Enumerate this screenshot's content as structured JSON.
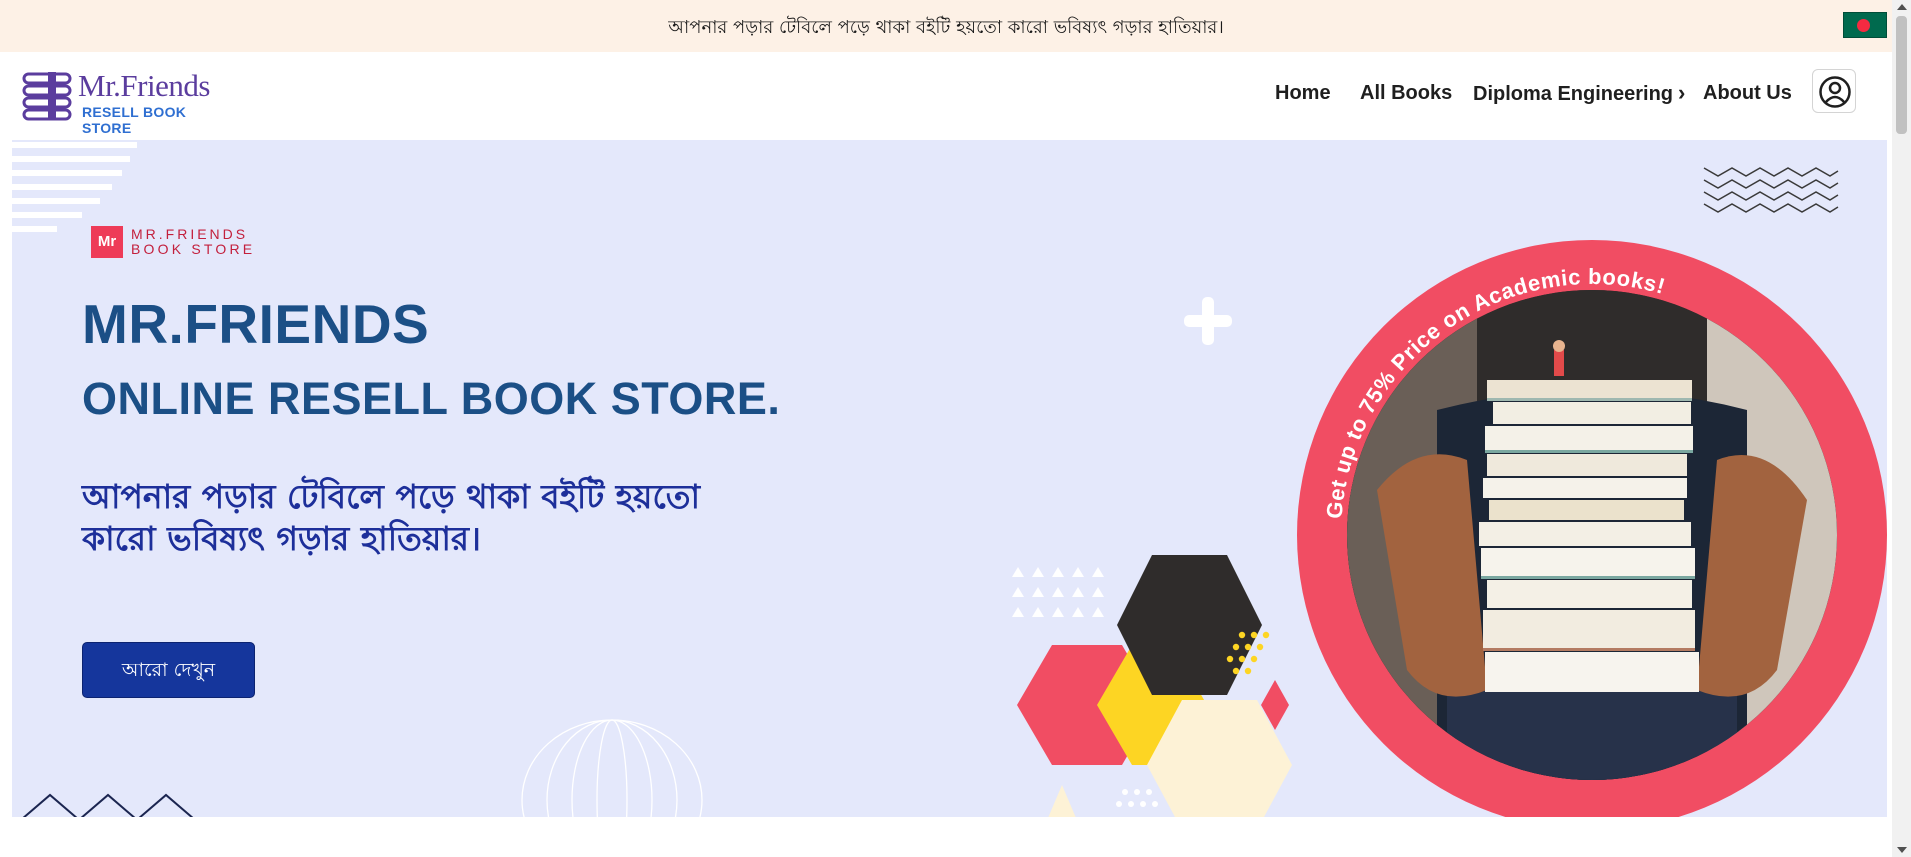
{
  "announcement": {
    "text": "আপনার পড়ার টেবিলে পড়ে থাকা বইটি হয়তো কারো ভবিষ্যৎ গড়ার হাতিয়ার।",
    "flag_icon": "bangladesh-flag-icon"
  },
  "header": {
    "logo_name": "Mr.Friends",
    "logo_tagline": "RESELL BOOK STORE",
    "nav": {
      "home": "Home",
      "all_books": "All Books",
      "diploma": "Diploma Engineering",
      "about": "About Us"
    },
    "user_icon": "user-circle-icon"
  },
  "hero": {
    "badge_box": "Mr",
    "badge_line1": "MR.FRIENDS",
    "badge_line2": "BOOK STORE",
    "title": "MR.FRIENDS",
    "subtitle": "ONLINE RESELL BOOK STORE.",
    "bangla_tagline": "আপনার পড়ার টেবিলে পড়ে থাকা বইটি হয়তো কারো ভবিষ্যৎ গড়ার হাতিয়ার।",
    "cta_label": "আরো দেখুন",
    "promo_text": "Get up to 75% Price on Academic books!"
  },
  "colors": {
    "announcement_bg": "#fdf1e6",
    "hero_bg": "#e4e8fb",
    "heading": "#1b4f86",
    "bangla_text": "#1d2f9a",
    "cta_bg": "#15369c",
    "ring": "#f14d63",
    "hex_yellow": "#fdd523",
    "hex_dark": "#2f2c2b",
    "hex_cream": "#fdf2d6"
  }
}
